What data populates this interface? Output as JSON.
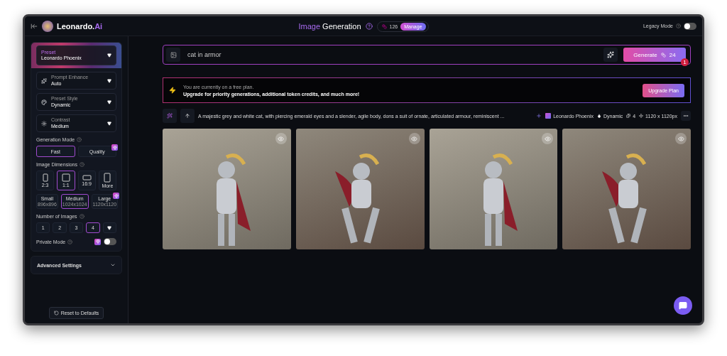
{
  "header": {
    "brand": {
      "name": "Leonardo.",
      "accent": "Ai"
    },
    "title": {
      "accent": "Image",
      "rest": "Generation"
    },
    "tokens": "126",
    "manage": "Manage",
    "legacy": {
      "label": "Legacy Mode",
      "on": false
    }
  },
  "sidebar": {
    "preset": {
      "label": "Preset",
      "value": "Leonardo Phoenix"
    },
    "dropdowns": [
      {
        "kind": "enhance",
        "label": "Prompt Enhance",
        "value": "Auto"
      },
      {
        "kind": "style",
        "label": "Preset Style",
        "value": "Dynamic"
      },
      {
        "kind": "contrast",
        "label": "Contrast",
        "value": "Medium"
      }
    ],
    "generation_mode": {
      "label": "Generation Mode",
      "options": [
        {
          "label": "Fast",
          "selected": true,
          "premium": false
        },
        {
          "label": "Quality",
          "selected": false,
          "premium": true
        }
      ]
    },
    "dimensions": {
      "label": "Image Dimensions",
      "ratios": [
        {
          "kind": "portrait",
          "label": "2:3",
          "selected": false
        },
        {
          "kind": "square",
          "label": "1:1",
          "selected": true
        },
        {
          "kind": "wide",
          "label": "16:9",
          "selected": false
        },
        {
          "kind": "tall",
          "label": "More",
          "selected": false
        }
      ],
      "sizes": [
        {
          "label": "Small",
          "sub": "896x896",
          "selected": false,
          "premium": false
        },
        {
          "label": "Medium",
          "sub": "1024x1024",
          "selected": true,
          "premium": false
        },
        {
          "label": "Large",
          "sub": "1120x1120",
          "selected": false,
          "premium": true
        }
      ]
    },
    "number_of_images": {
      "label": "Number of Images",
      "options": [
        {
          "label": "1",
          "selected": false
        },
        {
          "label": "2",
          "selected": false
        },
        {
          "label": "3",
          "selected": false
        },
        {
          "label": "4",
          "selected": true
        }
      ]
    },
    "private_mode": {
      "label": "Private Mode",
      "on": false,
      "premium": true
    },
    "advanced": {
      "label": "Advanced Settings",
      "expanded": false
    },
    "reset": "Reset to Defaults"
  },
  "prompt": {
    "value": "cat in armor",
    "generate": "Generate",
    "cost": "24",
    "badge": "1"
  },
  "banner": {
    "line1": "You are currently on a free plan.",
    "line2": "Upgrade for priority generations, additional token credits, and much more!",
    "button": "Upgrade Plan"
  },
  "generation": {
    "prompt": "A majestic grey and white cat, with piercing emerald eyes and a slender, agile body, dons a suit of ornate, articulated armour, reminiscent ...",
    "model": "Leonardo Phoenix",
    "style": "Dynamic",
    "count": "4",
    "size": "1120 x 1120px"
  },
  "images": [
    {
      "kind": "standing"
    },
    {
      "kind": "crouching"
    },
    {
      "kind": "standing"
    },
    {
      "kind": "crouching"
    }
  ]
}
